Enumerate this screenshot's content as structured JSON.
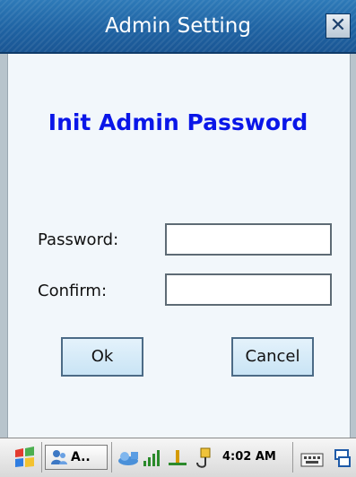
{
  "window": {
    "title": "Admin Setting",
    "close_label": "✕"
  },
  "form": {
    "heading": "Init Admin Password",
    "password_label": "Password:",
    "password_value": "",
    "confirm_label": "Confirm:",
    "confirm_value": ""
  },
  "buttons": {
    "ok": "Ok",
    "cancel": "Cancel"
  },
  "taskbar": {
    "app_label": "A..",
    "time": "4:02 AM"
  },
  "colors": {
    "heading": "#0a16e8",
    "titlebar": "#1f63a3"
  }
}
